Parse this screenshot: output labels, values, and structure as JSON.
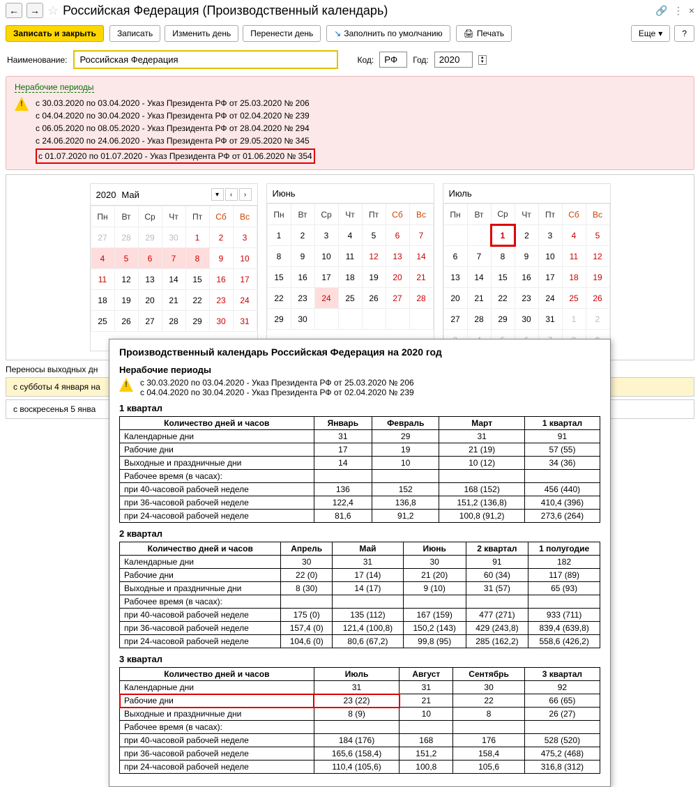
{
  "title": "Российская Федерация (Производственный календарь)",
  "toolbar": {
    "save_close": "Записать и закрыть",
    "save": "Записать",
    "change_day": "Изменить день",
    "move_day": "Перенести день",
    "fill_default": "Заполнить по умолчанию",
    "print": "Печать",
    "more": "Еще",
    "help": "?"
  },
  "form": {
    "name_label": "Наименование:",
    "name_value": "Российская Федерация",
    "code_label": "Код:",
    "code_value": "РФ",
    "year_label": "Год:",
    "year_value": "2020"
  },
  "nonwork": {
    "title": "Нерабочие периоды",
    "items": [
      "с 30.03.2020 по 03.04.2020 - Указ Президента РФ от 25.03.2020 № 206",
      "с 04.04.2020 по 30.04.2020 - Указ Президента РФ от 02.04.2020 № 239",
      "с 06.05.2020 по 08.05.2020 - Указ Президента РФ от 28.04.2020 № 294",
      "с 24.06.2020 по 24.06.2020 - Указ Президента РФ от 29.05.2020 № 345",
      "с 01.07.2020 по 01.07.2020 - Указ Президента РФ от 01.06.2020 № 354"
    ]
  },
  "wdays": [
    "Пн",
    "Вт",
    "Ср",
    "Чт",
    "Пт",
    "Сб",
    "Вс"
  ],
  "cal_may": {
    "year": "2020",
    "month": "Май"
  },
  "cal_jun": {
    "month": "Июнь"
  },
  "cal_jul": {
    "month": "Июль"
  },
  "transfers": {
    "title": "Переносы выходных дн",
    "row1": "с субботы 4 января на",
    "row2": "с воскресенья 5 янва"
  },
  "popup": {
    "title": "Производственный календарь Российская Федерация на 2020 год",
    "nw_title": "Нерабочие периоды",
    "nw_items": [
      "с 30.03.2020 по 03.04.2020 - Указ Президента РФ от 25.03.2020 № 206",
      "с 04.04.2020 по 30.04.2020 - Указ Президента РФ от 02.04.2020 № 239"
    ],
    "q1": {
      "title": "1 квартал",
      "head": [
        "Количество дней и часов",
        "Январь",
        "Февраль",
        "Март",
        "1 квартал"
      ],
      "rows": [
        [
          "Календарные дни",
          "31",
          "29",
          "31",
          "91"
        ],
        [
          "Рабочие дни",
          "17",
          "19",
          "21 (19)",
          "57 (55)"
        ],
        [
          "Выходные и праздничные дни",
          "14",
          "10",
          "10 (12)",
          "34 (36)"
        ],
        [
          "Рабочее время (в часах):",
          "",
          "",
          "",
          ""
        ],
        [
          "при 40-часовой рабочей неделе",
          "136",
          "152",
          "168 (152)",
          "456 (440)"
        ],
        [
          "при 36-часовой рабочей неделе",
          "122,4",
          "136,8",
          "151,2 (136,8)",
          "410,4 (396)"
        ],
        [
          "при 24-часовой рабочей неделе",
          "81,6",
          "91,2",
          "100,8 (91,2)",
          "273,6 (264)"
        ]
      ]
    },
    "q2": {
      "title": "2 квартал",
      "head": [
        "Количество дней и часов",
        "Апрель",
        "Май",
        "Июнь",
        "2 квартал",
        "1 полугодие"
      ],
      "rows": [
        [
          "Календарные дни",
          "30",
          "31",
          "30",
          "91",
          "182"
        ],
        [
          "Рабочие дни",
          "22 (0)",
          "17 (14)",
          "21 (20)",
          "60 (34)",
          "117 (89)"
        ],
        [
          "Выходные и праздничные дни",
          "8 (30)",
          "14 (17)",
          "9 (10)",
          "31 (57)",
          "65 (93)"
        ],
        [
          "Рабочее время (в часах):",
          "",
          "",
          "",
          "",
          ""
        ],
        [
          "при 40-часовой рабочей неделе",
          "175 (0)",
          "135 (112)",
          "167 (159)",
          "477 (271)",
          "933 (711)"
        ],
        [
          "при 36-часовой рабочей неделе",
          "157,4 (0)",
          "121,4 (100,8)",
          "150,2 (143)",
          "429 (243,8)",
          "839,4 (639,8)"
        ],
        [
          "при 24-часовой рабочей неделе",
          "104,6 (0)",
          "80,6 (67,2)",
          "99,8 (95)",
          "285 (162,2)",
          "558,6 (426,2)"
        ]
      ]
    },
    "q3": {
      "title": "3 квартал",
      "head": [
        "Количество дней и часов",
        "Июль",
        "Август",
        "Сентябрь",
        "3 квартал"
      ],
      "rows": [
        [
          "Календарные дни",
          "31",
          "31",
          "30",
          "92"
        ],
        [
          "Рабочие дни",
          "23 (22)",
          "21",
          "22",
          "66 (65)"
        ],
        [
          "Выходные и праздничные дни",
          "8 (9)",
          "10",
          "8",
          "26 (27)"
        ],
        [
          "Рабочее время (в часах):",
          "",
          "",
          "",
          ""
        ],
        [
          "при 40-часовой рабочей неделе",
          "184 (176)",
          "168",
          "176",
          "528 (520)"
        ],
        [
          "при 36-часовой рабочей неделе",
          "165,6 (158,4)",
          "151,2",
          "158,4",
          "475,2 (468)"
        ],
        [
          "при 24-часовой рабочей неделе",
          "110,4 (105,6)",
          "100,8",
          "105,6",
          "316,8 (312)"
        ]
      ]
    }
  },
  "chart_data": {
    "type": "table",
    "title": "Производственный календарь Российская Федерация на 2020 год",
    "quarters": [
      {
        "name": "1 квартал",
        "columns": [
          "Январь",
          "Февраль",
          "Март",
          "1 квартал"
        ],
        "calendar_days": [
          31,
          29,
          31,
          91
        ],
        "work_days": [
          "17",
          "19",
          "21 (19)",
          "57 (55)"
        ],
        "holidays": [
          "14",
          "10",
          "10 (12)",
          "34 (36)"
        ],
        "hours_40": [
          "136",
          "152",
          "168 (152)",
          "456 (440)"
        ],
        "hours_36": [
          "122,4",
          "136,8",
          "151,2 (136,8)",
          "410,4 (396)"
        ],
        "hours_24": [
          "81,6",
          "91,2",
          "100,8 (91,2)",
          "273,6 (264)"
        ]
      },
      {
        "name": "2 квартал",
        "columns": [
          "Апрель",
          "Май",
          "Июнь",
          "2 квартал",
          "1 полугодие"
        ],
        "calendar_days": [
          30,
          31,
          30,
          91,
          182
        ],
        "work_days": [
          "22 (0)",
          "17 (14)",
          "21 (20)",
          "60 (34)",
          "117 (89)"
        ],
        "holidays": [
          "8 (30)",
          "14 (17)",
          "9 (10)",
          "31 (57)",
          "65 (93)"
        ],
        "hours_40": [
          "175 (0)",
          "135 (112)",
          "167 (159)",
          "477 (271)",
          "933 (711)"
        ],
        "hours_36": [
          "157,4 (0)",
          "121,4 (100,8)",
          "150,2 (143)",
          "429 (243,8)",
          "839,4 (639,8)"
        ],
        "hours_24": [
          "104,6 (0)",
          "80,6 (67,2)",
          "99,8 (95)",
          "285 (162,2)",
          "558,6 (426,2)"
        ]
      },
      {
        "name": "3 квартал",
        "columns": [
          "Июль",
          "Август",
          "Сентябрь",
          "3 квартал"
        ],
        "calendar_days": [
          31,
          31,
          30,
          92
        ],
        "work_days": [
          "23 (22)",
          "21",
          "22",
          "66 (65)"
        ],
        "holidays": [
          "8 (9)",
          "10",
          "8",
          "26 (27)"
        ],
        "hours_40": [
          "184 (176)",
          "168",
          "176",
          "528 (520)"
        ],
        "hours_36": [
          "165,6 (158,4)",
          "151,2",
          "158,4",
          "475,2 (468)"
        ],
        "hours_24": [
          "110,4 (105,6)",
          "100,8",
          "105,6",
          "316,8 (312)"
        ]
      }
    ]
  }
}
